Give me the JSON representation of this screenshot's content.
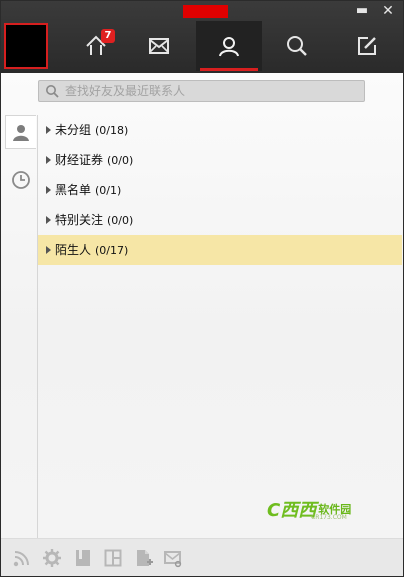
{
  "window": {
    "minimize_glyph": "▬",
    "close_glyph": "✕",
    "title_color": "#e00000"
  },
  "nav": {
    "tabs": [
      {
        "icon": "home-icon",
        "badge": "7",
        "active": false
      },
      {
        "icon": "mail-icon",
        "active": false
      },
      {
        "icon": "contacts-icon",
        "active": true
      },
      {
        "icon": "search-icon",
        "active": false
      },
      {
        "icon": "compose-icon",
        "active": false
      }
    ],
    "accent": "#d71f1f"
  },
  "search": {
    "placeholder": "查找好友及最近联系人"
  },
  "side_tabs": [
    {
      "icon": "person-icon",
      "active": true
    },
    {
      "icon": "clock-icon",
      "active": false
    }
  ],
  "groups": [
    {
      "name": "未分组",
      "count": "(0/18)",
      "selected": false
    },
    {
      "name": "财经证券",
      "count": "(0/0)",
      "selected": false
    },
    {
      "name": "黑名单",
      "count": "(0/1)",
      "selected": false
    },
    {
      "name": "特别关注",
      "count": "(0/0)",
      "selected": false
    },
    {
      "name": "陌生人",
      "count": "(0/17)",
      "selected": true
    }
  ],
  "watermark": {
    "logo": "C西西",
    "text": "软件园",
    "sub": "CR173.COM"
  },
  "toolbar": [
    {
      "icon": "rss-icon"
    },
    {
      "icon": "settings-gear-icon"
    },
    {
      "icon": "bookmark-icon"
    },
    {
      "icon": "layout-icon"
    },
    {
      "icon": "add-file-icon"
    },
    {
      "icon": "mail-link-icon"
    }
  ]
}
